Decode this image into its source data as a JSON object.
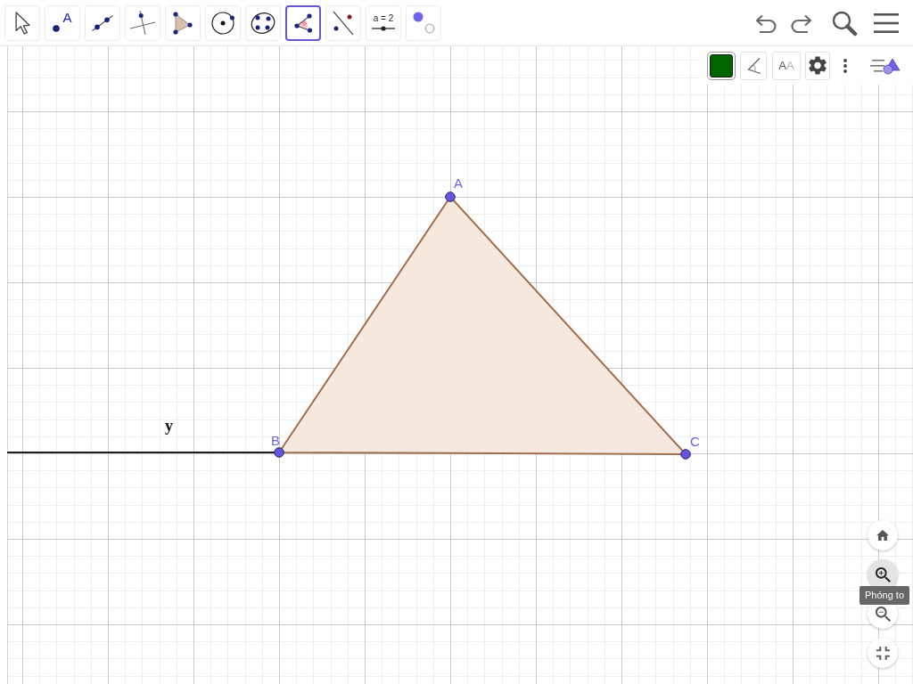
{
  "toolbar": {
    "tools": [
      {
        "kind": "move",
        "selected": false
      },
      {
        "kind": "point",
        "selected": false,
        "glyph": "A"
      },
      {
        "kind": "line",
        "selected": false
      },
      {
        "kind": "perpendicular",
        "selected": false
      },
      {
        "kind": "polygon",
        "selected": false
      },
      {
        "kind": "circle",
        "selected": false
      },
      {
        "kind": "conic",
        "selected": false
      },
      {
        "kind": "angle",
        "selected": true
      },
      {
        "kind": "reflect",
        "selected": false
      },
      {
        "kind": "slider",
        "selected": false,
        "glyph": "a = 2"
      },
      {
        "kind": "visibility",
        "selected": false
      }
    ]
  },
  "style_bar": {
    "color_swatch": {
      "color": "#006400"
    },
    "text_size_glyphs": [
      "A",
      "A"
    ]
  },
  "graphics": {
    "points": [
      {
        "label": "A"
      },
      {
        "label": "B"
      },
      {
        "label": "C"
      }
    ],
    "line": {
      "label": "y"
    }
  },
  "zoom_controls": {
    "buttons": [
      {
        "kind": "home",
        "hovered": false
      },
      {
        "kind": "zoom_in",
        "hovered": true
      },
      {
        "kind": "zoom_out",
        "hovered": false
      },
      {
        "kind": "fullscreen",
        "hovered": false
      }
    ],
    "tooltip": "Phóng to"
  }
}
